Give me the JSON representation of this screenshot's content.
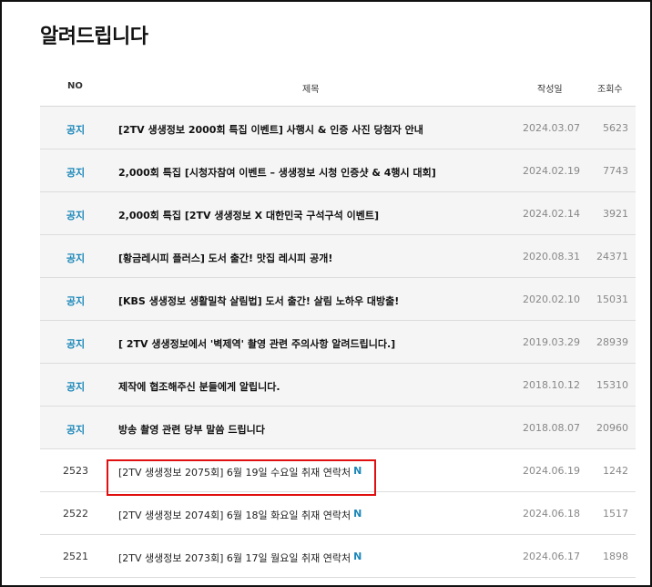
{
  "page": {
    "title": "알려드립니다"
  },
  "table": {
    "headers": {
      "no": "NO",
      "title": "제목",
      "date": "작성일",
      "views": "조회수"
    },
    "notices": [
      {
        "no": "공지",
        "title": "[2TV 생생정보 2000회 특집 이벤트] 사행시 & 인증 사진 당첨자 안내",
        "date": "2024.03.07",
        "views": "5623"
      },
      {
        "no": "공지",
        "title": "2,000회 특집 [시청자참여 이벤트 – 생생정보 시청 인증샷 & 4행시 대회]",
        "date": "2024.02.19",
        "views": "7743"
      },
      {
        "no": "공지",
        "title": "2,000회 특집 [2TV 생생정보 X 대한민국 구석구석 이벤트]",
        "date": "2024.02.14",
        "views": "3921"
      },
      {
        "no": "공지",
        "title": "[황금레시피 플러스] 도서 출간! 맛집 레시피 공개!",
        "date": "2020.08.31",
        "views": "24371"
      },
      {
        "no": "공지",
        "title": "[KBS 생생정보 생활밀착 살림법] 도서 출간! 살림 노하우 대방출!",
        "date": "2020.02.10",
        "views": "15031"
      },
      {
        "no": "공지",
        "title": "[ 2TV 생생정보에서 '벽제역' 촬영 관련 주의사항 알려드립니다.]",
        "date": "2019.03.29",
        "views": "28939"
      },
      {
        "no": "공지",
        "title": "제작에 협조해주신 분들에게 알립니다.",
        "date": "2018.10.12",
        "views": "15310"
      },
      {
        "no": "공지",
        "title": "방송 촬영 관련 당부 말씀 드립니다",
        "date": "2018.08.07",
        "views": "20960"
      }
    ],
    "posts": [
      {
        "no": "2523",
        "title": "[2TV 생생정보 2075회] 6월 19일 수요일 취재 연락처",
        "badge": "N",
        "date": "2024.06.19",
        "views": "1242"
      },
      {
        "no": "2522",
        "title": "[2TV 생생정보 2074회] 6월 18일 화요일 취재 연락처",
        "badge": "N",
        "date": "2024.06.18",
        "views": "1517"
      },
      {
        "no": "2521",
        "title": "[2TV 생생정보 2073회] 6월 17일 월요일 취재 연락처",
        "badge": "N",
        "date": "2024.06.17",
        "views": "1898"
      }
    ]
  },
  "colors": {
    "notice_label": "#1a86b8",
    "notice_row_bg": "#f5f5f5",
    "highlight_border": "#e01010"
  }
}
